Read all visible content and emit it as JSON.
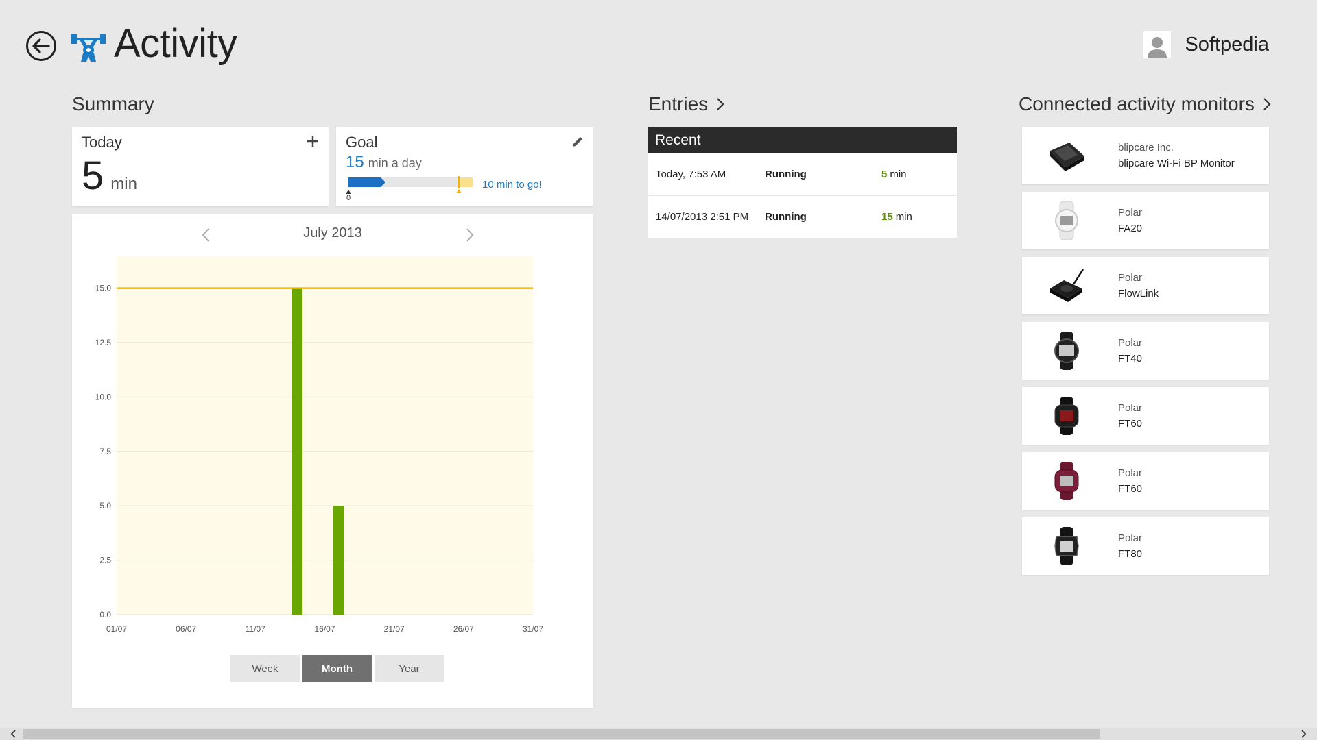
{
  "header": {
    "title": "Activity",
    "user_name": "Softpedia",
    "back_icon": "back-arrow-icon",
    "app_icon": "activity-icon"
  },
  "summary": {
    "heading": "Summary",
    "today": {
      "label": "Today",
      "value": "5",
      "unit": "min"
    },
    "goal": {
      "label": "Goal",
      "value": "15",
      "unit": "min a day",
      "progress_min": 5,
      "goal_min": 15,
      "zero_label": "0",
      "remaining_text": "10 min to go!"
    },
    "chart_nav": {
      "month": "July 2013"
    },
    "range_buttons": [
      "Week",
      "Month",
      "Year"
    ],
    "active_range": "Month"
  },
  "chart_data": {
    "type": "bar",
    "x": [
      "01/07",
      "06/07",
      "11/07",
      "16/07",
      "21/07",
      "26/07",
      "31/07"
    ],
    "x_tick_labels": [
      "01/07",
      "06/07",
      "11/07",
      "16/07",
      "21/07",
      "26/07",
      "31/07"
    ],
    "y_tick_labels": [
      "0.0",
      "2.5",
      "5.0",
      "7.5",
      "10.0",
      "12.5",
      "15.0"
    ],
    "ylim": [
      0,
      16.5
    ],
    "goal_line": 15,
    "bars": [
      {
        "day": 14,
        "value": 15
      },
      {
        "day": 17,
        "value": 5
      }
    ],
    "days_in_month": 31,
    "colors": {
      "bar": "#6aa600",
      "goal": "#f2b400",
      "plot_bg": "#fffbe8",
      "grid": "#dcdcd0"
    }
  },
  "entries": {
    "heading": "Entries",
    "list_title": "Recent",
    "rows": [
      {
        "date": "Today, 7:53 AM",
        "type": "Running",
        "duration": "5",
        "unit": "min"
      },
      {
        "date": "14/07/2013 2:51 PM",
        "type": "Running",
        "duration": "15",
        "unit": "min"
      }
    ]
  },
  "monitors": {
    "heading": "Connected activity monitors",
    "items": [
      {
        "brand": "blipcare Inc.",
        "model": "blipcare Wi-Fi BP Monitor",
        "icon": "bp-monitor-icon"
      },
      {
        "brand": "Polar",
        "model": "FA20",
        "icon": "watch-icon"
      },
      {
        "brand": "Polar",
        "model": "FlowLink",
        "icon": "flowlink-icon"
      },
      {
        "brand": "Polar",
        "model": "FT40",
        "icon": "watch-icon"
      },
      {
        "brand": "Polar",
        "model": "FT60",
        "icon": "watch-icon"
      },
      {
        "brand": "Polar",
        "model": "FT60",
        "icon": "watch-icon"
      },
      {
        "brand": "Polar",
        "model": "FT80",
        "icon": "watch-icon"
      }
    ]
  },
  "colors": {
    "accent": "#1b7bc5",
    "bar_green": "#6aa600",
    "goal_yellow": "#f2b400",
    "header_dark": "#2b2b2b"
  }
}
